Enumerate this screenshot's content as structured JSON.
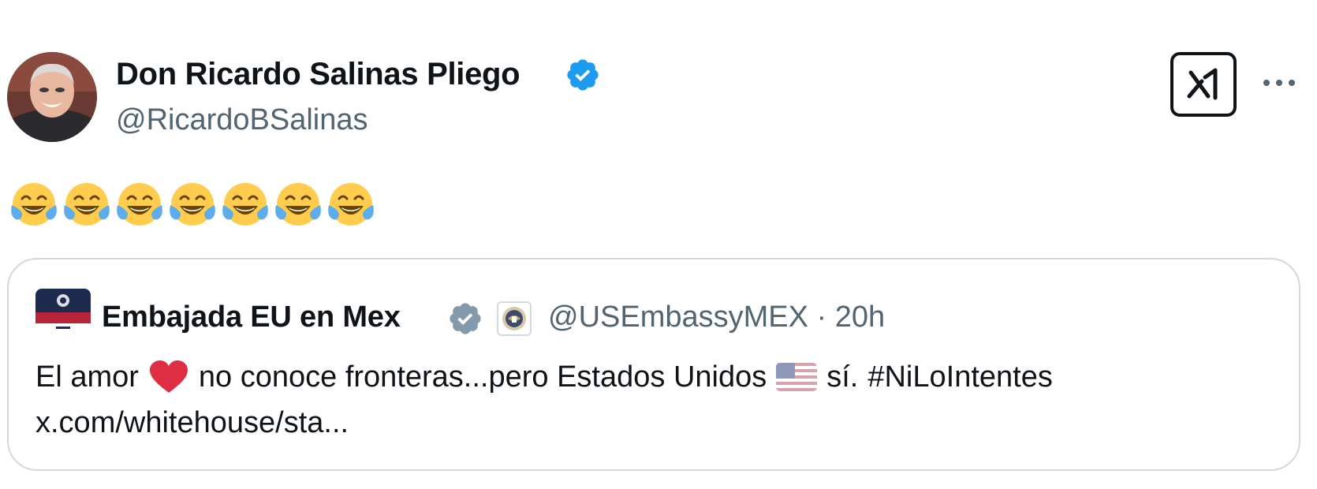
{
  "tweet": {
    "author_name": "Don Ricardo Salinas Pliego",
    "author_handle": "@RicardoBSalinas",
    "emoji_text": [
      "😂",
      "😂",
      "😂",
      "😂",
      "😂",
      "😂",
      "😂"
    ],
    "icons": {
      "verified": "verified-badge-icon",
      "grok": "grok-icon",
      "more": "more-options-icon"
    },
    "colors": {
      "verified_blue": "#1d9bf0",
      "gov_gray": "#829aab",
      "secondary_text": "#536471",
      "border": "#cfd9de"
    }
  },
  "quote": {
    "author_name": "Embajada EU en Mex",
    "handle": "@USEmbassyMEX",
    "separator": "·",
    "time": "20h",
    "text_part1": "El amor",
    "text_part2": "no conoce fronteras...pero Estados Unidos",
    "text_part3": "sí.",
    "hashtag": "#NiLoIntentes",
    "link": "x.com/whitehouse/sta..."
  }
}
